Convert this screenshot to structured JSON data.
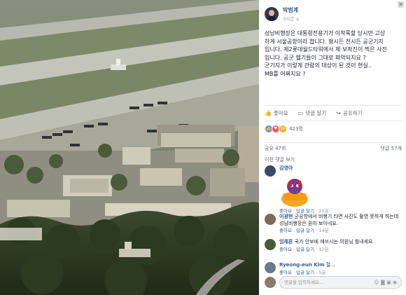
{
  "post": {
    "author": "박범계",
    "time": "3시간",
    "lines": [
      "성남비행장은 대통령전용기가 이착륙할 당시만 고상",
      "하게 서울공항이라 합니다. 평시든 전시든 공군기지",
      "입니다. 제2롯데월드타워에서 제 보좌진이 찍은 사진",
      "입니다. 공군 헬기들이 그대로 파악되지요 ?",
      "군기지가 이렇게 관람의 대상이 된 것이 현실..",
      "MB를 어쩌지요 ?"
    ]
  },
  "actions": {
    "like": "좋아요",
    "comment": "댓글 달기",
    "share": "공유하기"
  },
  "reactions": {
    "count": "423명",
    "icons": [
      "like-icon",
      "love-icon",
      "sad-icon"
    ],
    "colors": {
      "like": "#5890ff",
      "love": "#f25268",
      "sad": "#f7b125"
    }
  },
  "shares": {
    "left": "공유 47회",
    "right": "댓글 57개"
  },
  "more_comments": "이전 댓글 보기",
  "comments": [
    {
      "name": "김영아",
      "text": "",
      "like": "좋아요",
      "reply": "답글 달기",
      "time": "22분",
      "avatar_color": "#3b4a6b",
      "has_sticker": true
    },
    {
      "name": "이광현",
      "text": "군공항에서 비행기 타면 사진도 촬영 못하게 하는데 성남비행장은 훤히 보이네요.",
      "like": "좋아요",
      "reply": "답글 달기",
      "time": "14분",
      "avatar_color": "#7a6b5a",
      "has_sticker": false
    },
    {
      "name": "임채훈",
      "text": "국가 안보에 애쓰시는 의원님 힘내세요",
      "like": "좋아요",
      "reply": "답글 달기",
      "time": "12분",
      "avatar_color": "#4a5a3a",
      "has_sticker": false
    },
    {
      "name": "Ryeong-eun Kim",
      "text": "헐...",
      "like": "좋아요",
      "reply": "답글 달기",
      "time": "5분",
      "avatar_color": "#6b7a8a",
      "has_sticker": false
    }
  ],
  "input": {
    "placeholder": "댓글을 입력하세요..."
  },
  "close_label": "✕"
}
